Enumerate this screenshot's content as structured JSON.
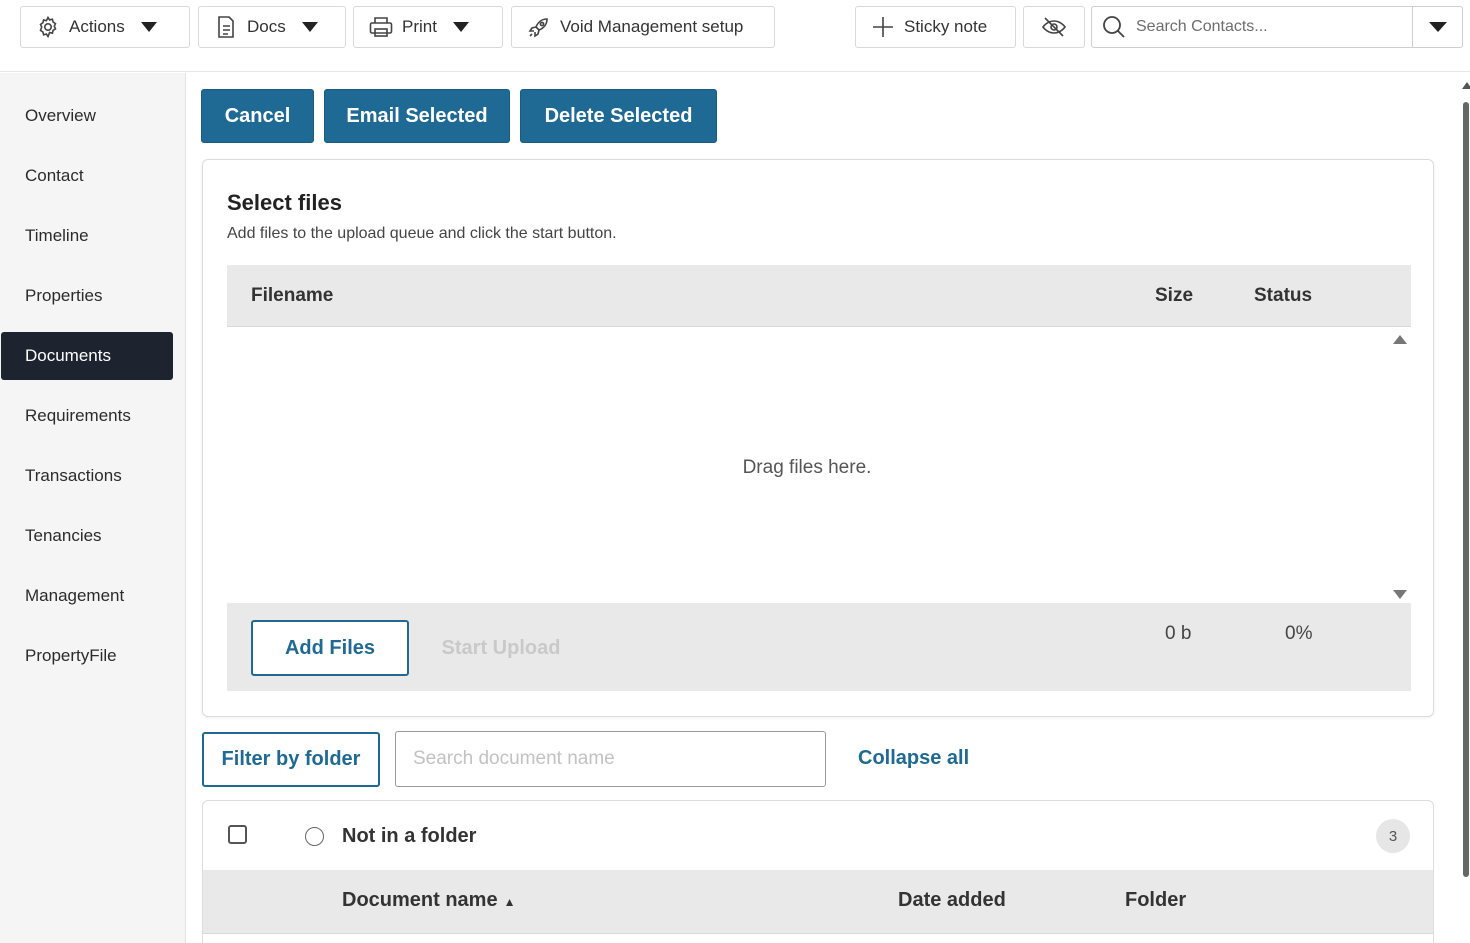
{
  "toolbar": {
    "actions_label": "Actions",
    "docs_label": "Docs",
    "print_label": "Print",
    "void_label": "Void Management setup",
    "sticky_label": "Sticky note",
    "search_placeholder": "Search Contacts..."
  },
  "sidebar": {
    "items": [
      {
        "label": "Overview"
      },
      {
        "label": "Contact"
      },
      {
        "label": "Timeline"
      },
      {
        "label": "Properties"
      },
      {
        "label": "Documents"
      },
      {
        "label": "Requirements"
      },
      {
        "label": "Transactions"
      },
      {
        "label": "Tenancies"
      },
      {
        "label": "Management"
      },
      {
        "label": "PropertyFile"
      }
    ],
    "active": "Documents"
  },
  "actions": {
    "cancel": "Cancel",
    "email_selected": "Email Selected",
    "delete_selected": "Delete Selected"
  },
  "upload": {
    "title": "Select files",
    "subtitle": "Add files to the upload queue and click the start button.",
    "columns": {
      "filename": "Filename",
      "size": "Size",
      "status": "Status"
    },
    "drop_text": "Drag files here.",
    "add_files": "Add Files",
    "start_upload": "Start Upload",
    "total_size": "0 b",
    "total_status": "0%"
  },
  "filters": {
    "filter_by_folder": "Filter by folder",
    "search_placeholder": "Search document name",
    "collapse_all": "Collapse all"
  },
  "folder": {
    "name": "Not in a folder",
    "count": "3",
    "columns": {
      "document_name": "Document name",
      "date_added": "Date added",
      "folder": "Folder"
    },
    "sort_indicator": "▲"
  },
  "colors": {
    "primary": "#1f6a94",
    "active_nav": "#1d2430",
    "header_bg": "#e9e9e9"
  }
}
